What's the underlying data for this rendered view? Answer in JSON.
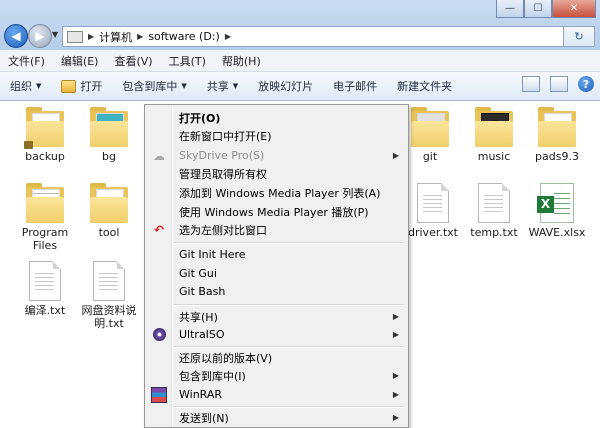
{
  "window": {
    "controls": {
      "minimize": "—",
      "maximize": "☐",
      "close": "✕"
    }
  },
  "address": {
    "segments": [
      "计算机",
      "software (D:)"
    ],
    "refresh_icon": "↻"
  },
  "menu": [
    "文件(F)",
    "编辑(E)",
    "查看(V)",
    "工具(T)",
    "帮助(H)"
  ],
  "toolbar": {
    "organize": "组织",
    "open": "打开",
    "include_library": "包含到库中",
    "share": "共享",
    "slideshow": "放映幻灯片",
    "email": "电子邮件",
    "new_folder": "新建文件夹",
    "help_glyph": "?"
  },
  "files": [
    {
      "name": "backup",
      "kind": "folder",
      "locked": true
    },
    {
      "name": "bg",
      "kind": "folder"
    },
    {
      "name": "git",
      "kind": "folder"
    },
    {
      "name": "music",
      "kind": "folder"
    },
    {
      "name": "pads9.3",
      "kind": "folder"
    },
    {
      "name": "Program Files",
      "kind": "folder"
    },
    {
      "name": "tool",
      "kind": "folder"
    },
    {
      "name": "driver.txt",
      "kind": "text"
    },
    {
      "name": "temp.txt",
      "kind": "text"
    },
    {
      "name": "WAVE.xlsx",
      "kind": "excel"
    },
    {
      "name": "编泽.txt",
      "kind": "text"
    },
    {
      "name": "网盘资料说明.txt",
      "kind": "text"
    }
  ],
  "context_menu": {
    "items": [
      {
        "label": "打开(O)",
        "bold": true
      },
      {
        "label": "在新窗口中打开(E)"
      },
      {
        "label": "SkyDrive Pro(S)",
        "disabled": true,
        "submenu": true,
        "icon": "cloud-icon"
      },
      {
        "label": "管理员取得所有权"
      },
      {
        "label": "添加到 Windows Media Player 列表(A)"
      },
      {
        "label": "使用 Windows Media Player 播放(P)"
      },
      {
        "label": "选为左侧对比窗口",
        "icon": "undo-arrow-icon"
      },
      {
        "label": "Git Init Here"
      },
      {
        "label": "Git Gui"
      },
      {
        "label": "Git Bash"
      },
      {
        "label": "共享(H)",
        "submenu": true
      },
      {
        "label": "UltraISO",
        "submenu": true,
        "icon": "ultraiso-disc-icon"
      },
      {
        "label": "还原以前的版本(V)"
      },
      {
        "label": "包含到库中(I)",
        "submenu": true
      },
      {
        "label": "WinRAR",
        "submenu": true,
        "icon": "winrar-icon"
      },
      {
        "label": "发送到(N)",
        "submenu": true
      }
    ],
    "submenu_glyph": "▶"
  },
  "colors": {
    "accent": "#1c5fb8",
    "menu_bg": "#f0f0f0",
    "folder": "#f0cf6a"
  }
}
